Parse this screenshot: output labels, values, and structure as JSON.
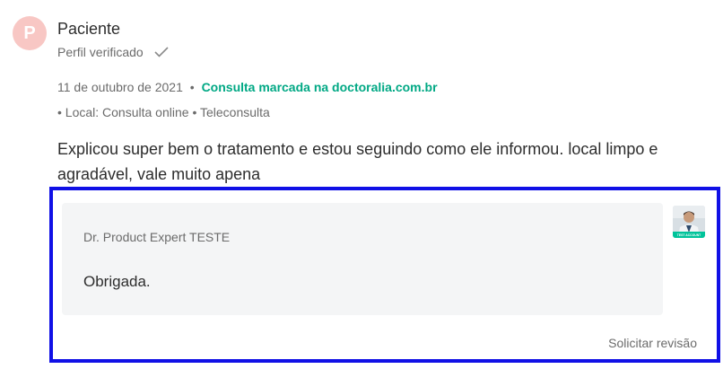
{
  "patient": {
    "avatar_letter": "P",
    "name": "Paciente",
    "verified_label": "Perfil verificado"
  },
  "meta": {
    "date": "11 de outubro de 2021",
    "separator": "•",
    "booking_link": "Consulta marcada na doctoralia.com.br",
    "location_line": "• Local: Consulta online • Teleconsulta"
  },
  "review": {
    "text": "Explicou super bem o tratamento e estou seguindo como ele informou. local limpo e agradável, vale muito apena"
  },
  "reply": {
    "doctor_name": "Dr. Product Expert TESTE",
    "text": "Obrigada.",
    "avatar_badge": "TEST ACCOUNT",
    "revision_link": "Solicitar revisão"
  },
  "colors": {
    "link_green": "#00a884",
    "highlight_blue": "#1010e6",
    "avatar_pink": "#f8c7c4",
    "reply_bg": "#f4f5f6"
  }
}
